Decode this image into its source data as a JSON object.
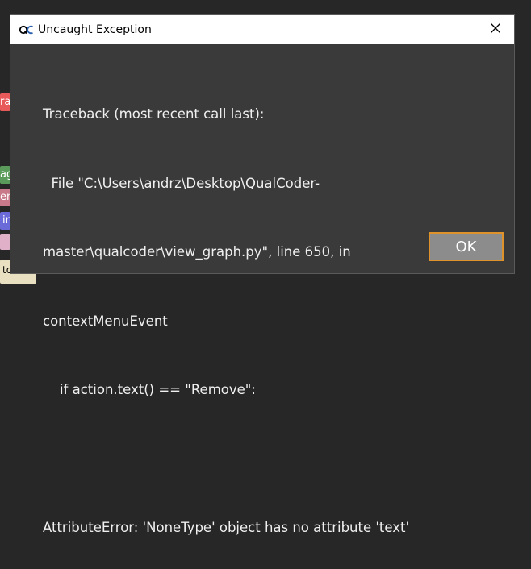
{
  "background": {
    "tags": [
      {
        "text": "ra",
        "bg": "#e85a5a",
        "color": "#ffffff"
      },
      {
        "text": "ag",
        "bg": "#5a9a5a",
        "color": "#ffffff"
      },
      {
        "text": "ent",
        "bg": "#c87a8a",
        "color": "#ffffff"
      },
      {
        "text": "in",
        "bg": "#6a6ad8",
        "color": "#ffffff"
      },
      {
        "text": "",
        "bg": "#e0b0c8",
        "color": "#ffffff"
      },
      {
        "text": "to lab",
        "bg": "#e8e0c0",
        "color": "#000000"
      }
    ]
  },
  "dialog": {
    "title": "Uncaught Exception",
    "app_icon": "qualcoder-logo-icon",
    "close_icon": "close-icon",
    "message_lines": [
      "Traceback (most recent call last):",
      "  File \"C:\\Users\\andrz\\Desktop\\QualCoder-",
      "master\\qualcoder\\view_graph.py\", line 650, in",
      "contextMenuEvent",
      "    if action.text() == \"Remove\":",
      "",
      "AttributeError: 'NoneType' object has no attribute 'text'"
    ],
    "ok_label": "OK"
  },
  "colors": {
    "dialog_bg": "#3a3a3a",
    "text": "#f0f0f0",
    "ok_bg": "#8c8c8c",
    "ok_border": "#e0922a"
  }
}
